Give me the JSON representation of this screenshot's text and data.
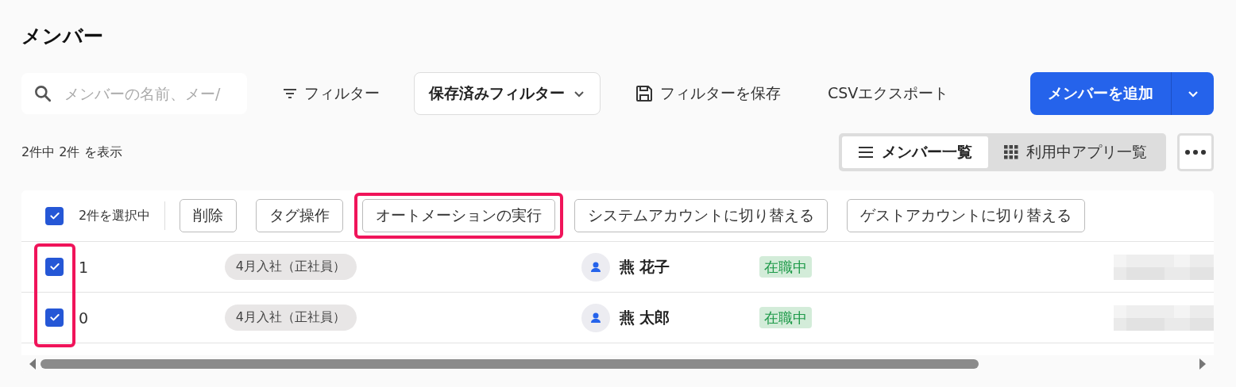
{
  "title": "メンバー",
  "search": {
    "placeholder": "メンバーの名前、メー/"
  },
  "toolbar": {
    "filter": "フィルター",
    "saved_filter": "保存済みフィルター",
    "save_filter": "フィルターを保存",
    "csv_export": "CSVエクスポート",
    "add_member": "メンバーを追加"
  },
  "result_count": "2件中 2件 を表示",
  "view_tabs": [
    {
      "label": "メンバー一覧",
      "kind": "list",
      "selected": true
    },
    {
      "label": "利用中アプリ一覧",
      "kind": "grid",
      "selected": false
    }
  ],
  "bulk_bar": {
    "checked": true,
    "selection_label": "2件を選択中",
    "actions": [
      {
        "label": "削除",
        "highlighted": false
      },
      {
        "label": "タグ操作",
        "highlighted": false
      },
      {
        "label": "オートメーションの実行",
        "highlighted": true
      },
      {
        "label": "システムアカウントに切り替える",
        "highlighted": false
      },
      {
        "label": "ゲストアカウントに切り替える",
        "highlighted": false
      }
    ]
  },
  "table": {
    "checkbox_column_highlighted": true,
    "rows": [
      {
        "checked": true,
        "number": "1",
        "tag": "4月入社（正社員）",
        "name": "燕 花子",
        "status": "在職中"
      },
      {
        "checked": true,
        "number": "0",
        "tag": "4月入社（正社員）",
        "name": "燕 太郎",
        "status": "在職中"
      }
    ]
  }
}
